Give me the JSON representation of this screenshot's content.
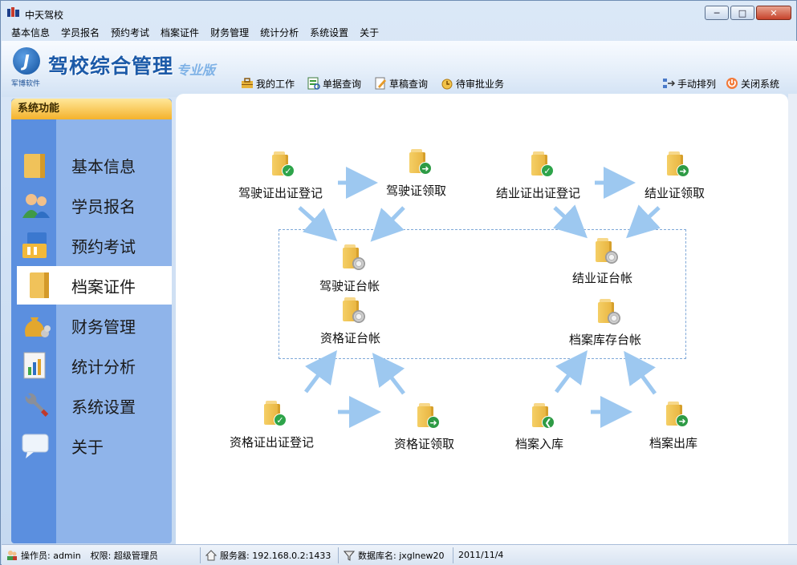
{
  "window": {
    "title": "中天驾校"
  },
  "menu": [
    "基本信息",
    "学员报名",
    "预约考试",
    "档案证件",
    "财务管理",
    "统计分析",
    "系统设置",
    "关于"
  ],
  "header": {
    "logo_sub": "军博软件",
    "app_title": "驾校综合管理",
    "edition": "专业版"
  },
  "toolbar": {
    "left": [
      {
        "label": "我的工作",
        "icon": "my-work-icon"
      },
      {
        "label": "单据查询",
        "icon": "document-query-icon"
      },
      {
        "label": "草稿查询",
        "icon": "draft-query-icon"
      },
      {
        "label": "待审批业务",
        "icon": "pending-approval-icon"
      }
    ],
    "right": [
      {
        "label": "手动排列",
        "icon": "arrange-icon"
      },
      {
        "label": "关闭系统",
        "icon": "power-icon"
      }
    ]
  },
  "sidebar": {
    "header": "系统功能",
    "items": [
      {
        "label": "基本信息",
        "icon": "folder-icon"
      },
      {
        "label": "学员报名",
        "icon": "users-icon"
      },
      {
        "label": "预约考试",
        "icon": "calendar-folder-icon"
      },
      {
        "label": "档案证件",
        "icon": "folder-icon",
        "active": true
      },
      {
        "label": "财务管理",
        "icon": "money-bag-icon"
      },
      {
        "label": "统计分析",
        "icon": "chart-icon"
      },
      {
        "label": "系统设置",
        "icon": "wrench-icon"
      },
      {
        "label": "关于",
        "icon": "speech-bubble-icon"
      }
    ]
  },
  "flow": {
    "nodes": {
      "jszcz_dj": "驾驶证出证登记",
      "jsz_lq": "驾驶证领取",
      "jyzcz_dj": "结业证出证登记",
      "jyz_lq": "结业证领取",
      "jsz_tz": "驾驶证台帐",
      "jyz_tz": "结业证台帐",
      "zgz_tz": "资格证台帐",
      "daku_tz": "档案库存台帐",
      "zgzcz_dj": "资格证出证登记",
      "zgz_lq": "资格证领取",
      "da_rk": "档案入库",
      "da_ck": "档案出库"
    }
  },
  "status": {
    "operator": "操作员: admin",
    "role": "权限: 超级管理员",
    "server": "服务器: 192.168.0.2:1433",
    "database": "数据库名: jxglnew20",
    "date": "2011/11/4"
  }
}
